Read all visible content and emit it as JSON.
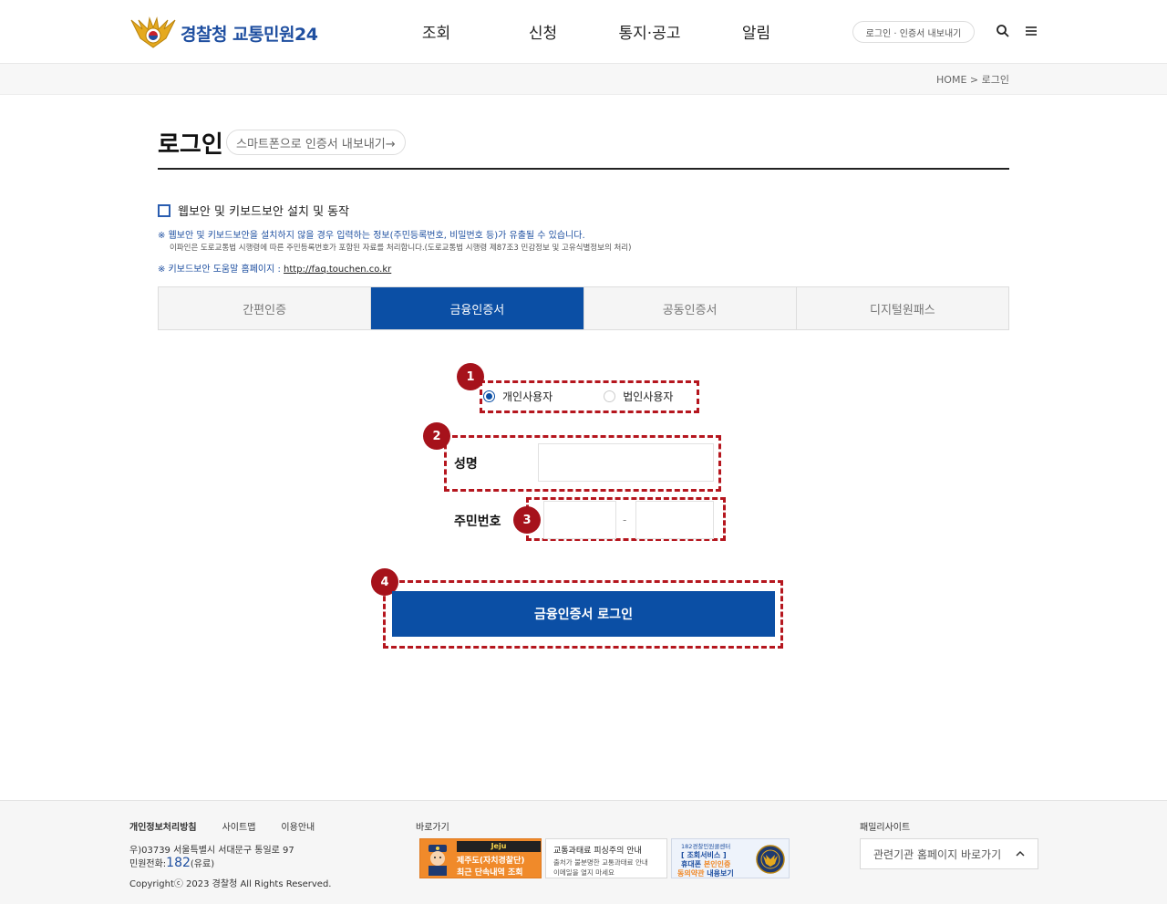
{
  "header": {
    "logo_text": "경찰청 교통민원24",
    "nav": [
      "조회",
      "신청",
      "통지·공고",
      "알림"
    ],
    "login_pill": "로그인 · 인증서 내보내기",
    "search_icon": "search-icon",
    "menu_icon": "hamburger-menu-icon"
  },
  "breadcrumb": {
    "home": "HOME",
    "separator": ">",
    "current": "로그인"
  },
  "page": {
    "title": "로그인",
    "smart_phone_button": "스마트폰으로 인증서 내보내기→"
  },
  "security": {
    "checkbox_label": "웹보안 및 키보드보안 설치 및 동작",
    "notice_1": "※ 웹보안 및 키보드보안을 설치하지 않을 경우 입력하는 정보(주민등록번호, 비밀번호 등)가 유출될 수 있습니다.",
    "notice_1b": "이파인은 도로교통법 시행령에 따른 주민등록번호가 포함된 자료를 처리합니다.(도로교통법 시행령 제87조3 민감정보 및 고유식별정보의 처리)",
    "notice_2_prefix": "※ 키보드보안 도움말 홈페이지 : ",
    "notice_2_link": "http://faq.touchen.co.kr"
  },
  "tabs": [
    {
      "label": "간편인증",
      "active": false
    },
    {
      "label": "금융인증서",
      "active": true
    },
    {
      "label": "공동인증서",
      "active": false
    },
    {
      "label": "디지털원패스",
      "active": false
    }
  ],
  "form": {
    "user_type_options": [
      {
        "label": "개인사용자",
        "selected": true
      },
      {
        "label": "법인사용자",
        "selected": false
      }
    ],
    "name_label": "성명",
    "name_value": "",
    "id_label": "주민번호",
    "id_front_value": "",
    "id_separator": "-",
    "id_back_value": "",
    "submit_label": "금융인증서 로그인",
    "markers": [
      "1",
      "2",
      "3",
      "4"
    ],
    "marker_color": "#a6121b"
  },
  "footer": {
    "links": [
      "개인정보처리방침",
      "사이트맵",
      "이용안내"
    ],
    "address": "우)03739 서울특별시 서대문구 통일로 97",
    "tel_label": "민원전화:",
    "tel_number": "182",
    "tel_suffix": "(유료)",
    "copyright": "Copyrightⓒ 2023 경찰청 All Rights Reserved.",
    "shortcut_label": "바로가기",
    "banner_1": {
      "top": "Jeju",
      "line_2": "제주도(자치경찰단)",
      "line_3": "최근 단속내역 조회"
    },
    "banner_2": {
      "title": "교통과태료 피싱주의 안내",
      "line_1": "출처가 불분명한 교통과태료 안내",
      "line_2": "이메일을 열지 마세요"
    },
    "banner_3": {
      "small": "182경찰민원콜센터",
      "line_1": "[ 조회서비스 ]",
      "line_2_a": "휴대폰 ",
      "line_2_b": "본인인증",
      "line_3_a": "동의약관",
      "line_3_b": " 내용보기"
    },
    "family_label": "패밀리사이트",
    "family_select": "관련기관 홈페이지 바로가기"
  },
  "colors": {
    "primary": "#0b4fa5",
    "marker": "#a6121b",
    "accent": "#f08a2a"
  }
}
